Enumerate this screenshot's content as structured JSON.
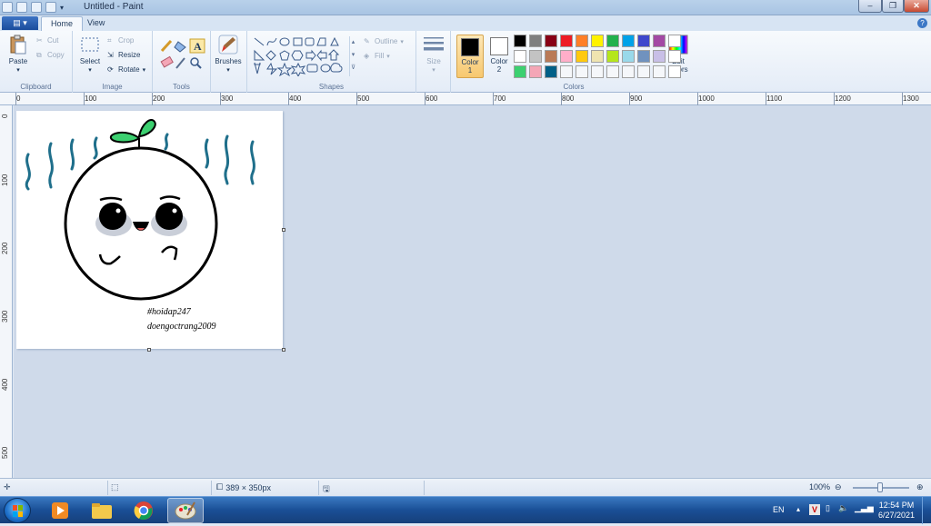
{
  "window": {
    "title": "Untitled - Paint"
  },
  "tabs": {
    "home": "Home",
    "view": "View"
  },
  "clipboard": {
    "paste": "Paste",
    "cut": "Cut",
    "copy": "Copy",
    "label": "Clipboard"
  },
  "image": {
    "select": "Select",
    "crop": "Crop",
    "resize": "Resize",
    "rotate": "Rotate",
    "label": "Image"
  },
  "tools": {
    "label": "Tools"
  },
  "brushes": {
    "label": "Brushes"
  },
  "shapes": {
    "label": "Shapes",
    "outline": "Outline",
    "fill": "Fill"
  },
  "size": {
    "label": "Size"
  },
  "colors": {
    "label": "Colors",
    "color1_label": "Color",
    "color1_num": "1",
    "color2_label": "Color",
    "color2_num": "2",
    "edit": "Edit colors",
    "color1_value": "#000000",
    "color2_value": "#ffffff",
    "palette": [
      "#000000",
      "#7f7f7f",
      "#880015",
      "#ed1c24",
      "#ff7f27",
      "#fff200",
      "#22b14c",
      "#00a2e8",
      "#3f48cc",
      "#a349a4",
      "#ffffff",
      "#ffffff",
      "#c3c3c3",
      "#b97a57",
      "#ffaec9",
      "#ffc90e",
      "#efe4b0",
      "#b5e61d",
      "#99d9ea",
      "#7092be",
      "#c8bfe7",
      "#ffffff",
      "#3cd070",
      "#f4a6b6",
      "#005f87",
      "#f5f7fa",
      "#f5f7fa",
      "#f5f7fa",
      "#f5f7fa",
      "#f5f7fa",
      "#f5f7fa",
      "#f5f7fa",
      "#ffffff"
    ]
  },
  "ruler_top": [
    "0",
    "100",
    "200",
    "300",
    "400",
    "500",
    "600",
    "700",
    "800",
    "900",
    "1000",
    "1100",
    "1200",
    "1300"
  ],
  "ruler_left": [
    "0",
    "100",
    "200",
    "300",
    "400",
    "500"
  ],
  "drawing": {
    "text_line1": "#hoidap247",
    "text_line2": "doengoctrang2009"
  },
  "status": {
    "size": "389 × 350px",
    "zoom": "100%"
  },
  "taskbar": {
    "lang": "EN",
    "time": "12:54 PM",
    "date": "6/27/2021"
  }
}
